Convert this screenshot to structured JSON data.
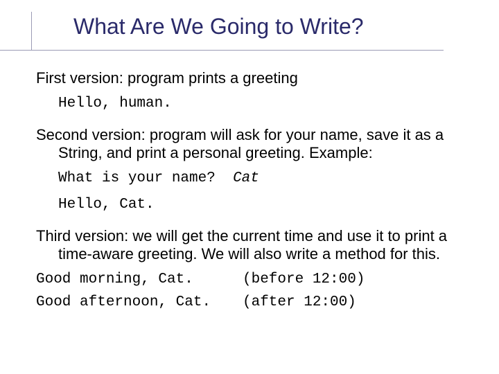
{
  "title": "What Are We Going to Write?",
  "p1": "First version:  program prints a greeting",
  "c1": "Hello, human.",
  "p2": "Second version:  program will ask for your name, save it as a String, and print a personal greeting. Example:",
  "c2a": "What is your name?",
  "c2b": "Cat",
  "c3": "Hello, Cat.",
  "p3": "Third version: we will get the current time and use it to print a time-aware greeting.  We will also write a method for this.",
  "r1a": "Good morning, Cat.",
  "r1b": "(before 12:00)",
  "r2a": "Good afternoon, Cat.",
  "r2b": "(after 12:00)"
}
